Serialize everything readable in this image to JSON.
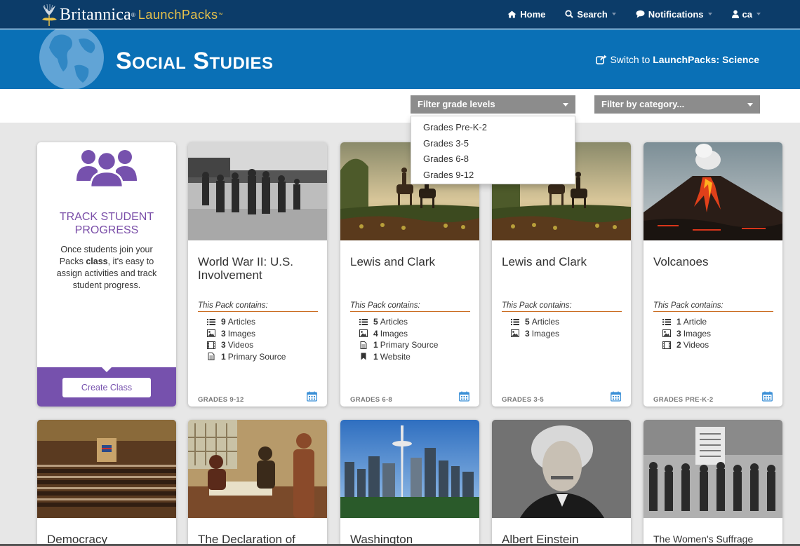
{
  "brand": {
    "name": "Britannica",
    "reg": "®",
    "product": "LaunchPacks",
    "tm": "™"
  },
  "nav": {
    "home": "Home",
    "search": "Search",
    "notifications": "Notifications",
    "user": "ca"
  },
  "banner": {
    "title": "Social Studies",
    "switch_prefix": "Switch to",
    "switch_target": "LaunchPacks: Science"
  },
  "filters": {
    "grade_label": "Filter grade levels",
    "category_label": "Filter by category...",
    "grade_options": [
      "Grades Pre-K-2",
      "Grades 3-5",
      "Grades 6-8",
      "Grades 9-12"
    ]
  },
  "track": {
    "title_line1": "TRACK STUDENT",
    "title_line2": "PROGRESS",
    "text_before": "Once students join your Packs",
    "text_bold": "class",
    "text_after": ", it's easy to assign activities and track student progress.",
    "button": "Create Class"
  },
  "contains_label": "This Pack contains:",
  "cards": [
    {
      "title": "World War II: U.S. Involvement",
      "items": [
        {
          "icon": "list-icon",
          "count": "9",
          "label": "Articles"
        },
        {
          "icon": "image-icon",
          "count": "3",
          "label": "Images"
        },
        {
          "icon": "film-icon",
          "count": "3",
          "label": "Videos"
        },
        {
          "icon": "document-icon",
          "count": "1",
          "label": "Primary Source"
        }
      ],
      "grade": "GRADES 9-12"
    },
    {
      "title": "Lewis and Clark",
      "items": [
        {
          "icon": "list-icon",
          "count": "5",
          "label": "Articles"
        },
        {
          "icon": "image-icon",
          "count": "4",
          "label": "Images"
        },
        {
          "icon": "document-icon",
          "count": "1",
          "label": "Primary Source"
        },
        {
          "icon": "bookmark-icon",
          "count": "1",
          "label": "Website"
        }
      ],
      "grade": "GRADES 6-8"
    },
    {
      "title": "Lewis and Clark",
      "items": [
        {
          "icon": "list-icon",
          "count": "5",
          "label": "Articles"
        },
        {
          "icon": "image-icon",
          "count": "3",
          "label": "Images"
        }
      ],
      "grade": "GRADES 3-5"
    },
    {
      "title": "Volcanoes",
      "items": [
        {
          "icon": "list-icon",
          "count": "1",
          "label": "Article"
        },
        {
          "icon": "image-icon",
          "count": "3",
          "label": "Images"
        },
        {
          "icon": "film-icon",
          "count": "2",
          "label": "Videos"
        }
      ],
      "grade": "GRADES PRE-K-2"
    }
  ],
  "bottom_cards": [
    {
      "title": "Democracy"
    },
    {
      "title": "The Declaration of"
    },
    {
      "title": "Washington"
    },
    {
      "title": "Albert Einstein"
    },
    {
      "title": "The Women's Suffrage"
    }
  ]
}
